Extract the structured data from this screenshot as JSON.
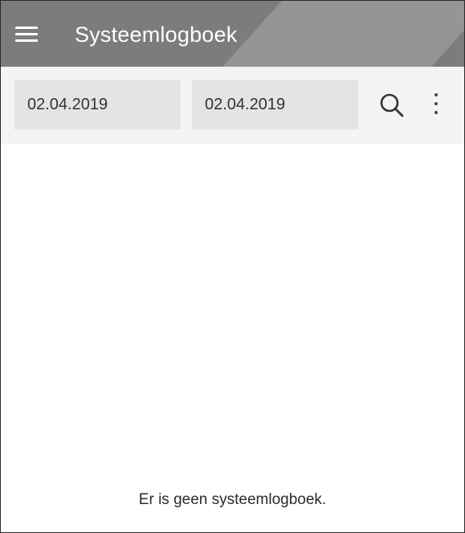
{
  "app_bar": {
    "title": "Systeemlogboek",
    "menu_icon": "hamburger-menu-icon"
  },
  "toolbar": {
    "start_date": "02.04.2019",
    "end_date": "02.04.2019",
    "search_icon": "search-icon",
    "more_icon": "more-vertical-icon"
  },
  "content": {
    "empty_message": "Er is geen systeemlogboek."
  },
  "colors": {
    "app_bar": "#7c7c7c",
    "toolbar": "#f4f4f4",
    "date_field": "#e4e4e4",
    "text": "#333333"
  }
}
